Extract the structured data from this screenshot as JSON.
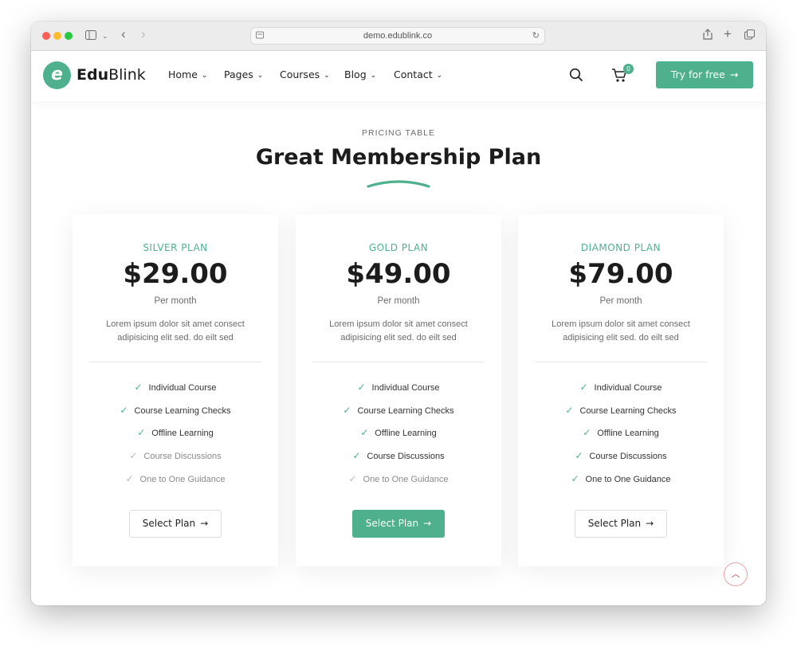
{
  "browser": {
    "url": "demo.edublink.co"
  },
  "header": {
    "logo_letter": "e",
    "logo_brand_bold": "Edu",
    "logo_brand_rest": "Blink",
    "nav": [
      {
        "label": "Home"
      },
      {
        "label": "Pages"
      },
      {
        "label": "Courses"
      },
      {
        "label": "Blog"
      },
      {
        "label": "Contact"
      }
    ],
    "cart_count": "0",
    "cta_label": "Try for free",
    "accent_color": "#4fb08e"
  },
  "section": {
    "subtitle": "PRICING TABLE",
    "title": "Great Membership Plan"
  },
  "plans": [
    {
      "name": "SILVER PLAN",
      "price": "$29.00",
      "period": "Per month",
      "description": "Lorem ipsum dolor sit amet consect adipisicing elit sed. do eilt sed",
      "features": [
        {
          "label": "Individual Course",
          "included": true
        },
        {
          "label": "Course Learning Checks",
          "included": true
        },
        {
          "label": "Offline Learning",
          "included": true
        },
        {
          "label": "Course Discussions",
          "included": false
        },
        {
          "label": "One to One Guidance",
          "included": false
        }
      ],
      "button_label": "Select Plan",
      "highlighted": false
    },
    {
      "name": "GOLD PLAN",
      "price": "$49.00",
      "period": "Per month",
      "description": "Lorem ipsum dolor sit amet consect adipisicing elit sed. do eilt sed",
      "features": [
        {
          "label": "Individual Course",
          "included": true
        },
        {
          "label": "Course Learning Checks",
          "included": true
        },
        {
          "label": "Offline Learning",
          "included": true
        },
        {
          "label": "Course Discussions",
          "included": true
        },
        {
          "label": "One to One Guidance",
          "included": false
        }
      ],
      "button_label": "Select Plan",
      "highlighted": true
    },
    {
      "name": "DIAMOND PLAN",
      "price": "$79.00",
      "period": "Per month",
      "description": "Lorem ipsum dolor sit amet consect adipisicing elit sed. do eilt sed",
      "features": [
        {
          "label": "Individual Course",
          "included": true
        },
        {
          "label": "Course Learning Checks",
          "included": true
        },
        {
          "label": "Offline Learning",
          "included": true
        },
        {
          "label": "Course Discussions",
          "included": true
        },
        {
          "label": "One to One Guidance",
          "included": true
        }
      ],
      "button_label": "Select Plan",
      "highlighted": false
    }
  ],
  "icons": {
    "check": "check-icon",
    "arrow": "arrow-right-icon",
    "scroll_top": "chevron-up-icon"
  }
}
